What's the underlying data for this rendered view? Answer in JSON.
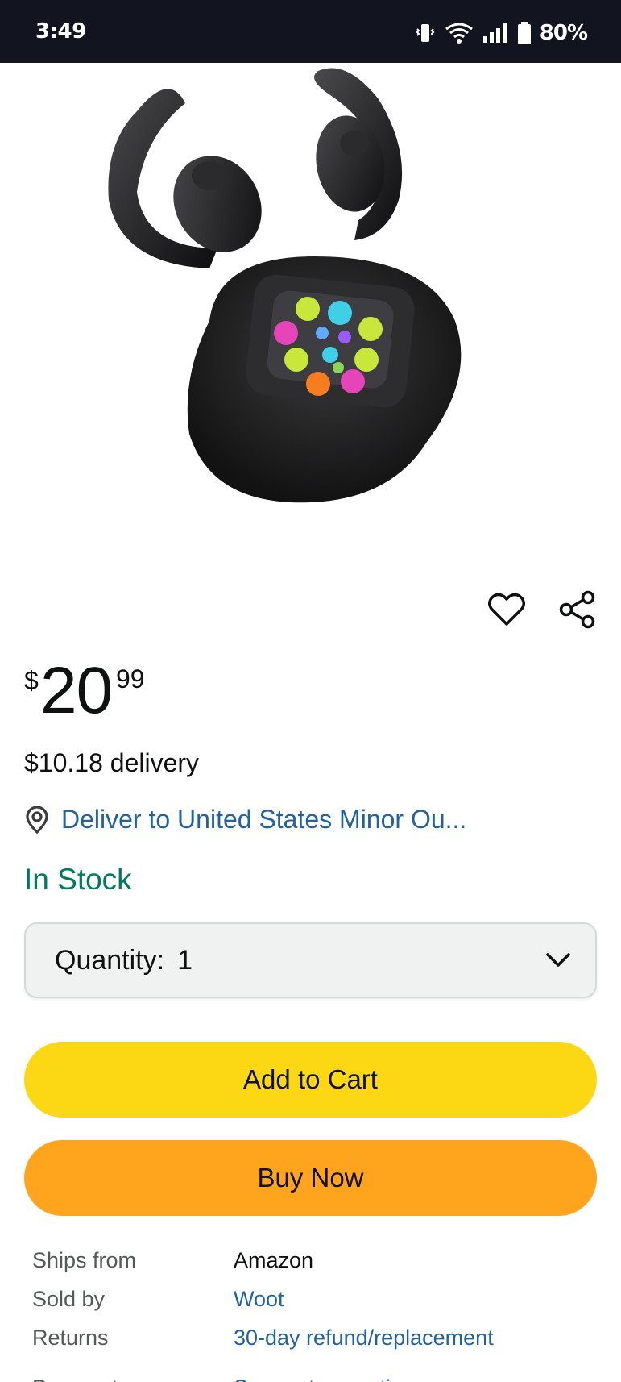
{
  "status_bar": {
    "time": "3:49",
    "battery": "80%"
  },
  "product": {
    "image_alt": "Open-ear wireless earbuds with touchscreen charging case"
  },
  "price": {
    "symbol": "$",
    "whole": "20",
    "fraction": "99"
  },
  "delivery_fee": "$10.18 delivery",
  "deliver_to": "Deliver to United States Minor Ou...",
  "stock": "In Stock",
  "quantity": {
    "label": "Quantity:",
    "value": "1"
  },
  "buttons": {
    "add_to_cart": "Add to Cart",
    "buy_now": "Buy Now"
  },
  "details": [
    {
      "key": "Ships from",
      "value": "Amazon"
    },
    {
      "key": "Sold by",
      "value": "Woot"
    },
    {
      "key": "Returns",
      "value": "30-day refund/replacement"
    },
    {
      "key": "Payment",
      "value": "Secure transaction"
    }
  ],
  "colors": {
    "status_bar": "#121420",
    "link": "#2162a1",
    "in_stock": "#007a5e",
    "add_to_cart": "#fcd814",
    "buy_now": "#ffa41c"
  }
}
